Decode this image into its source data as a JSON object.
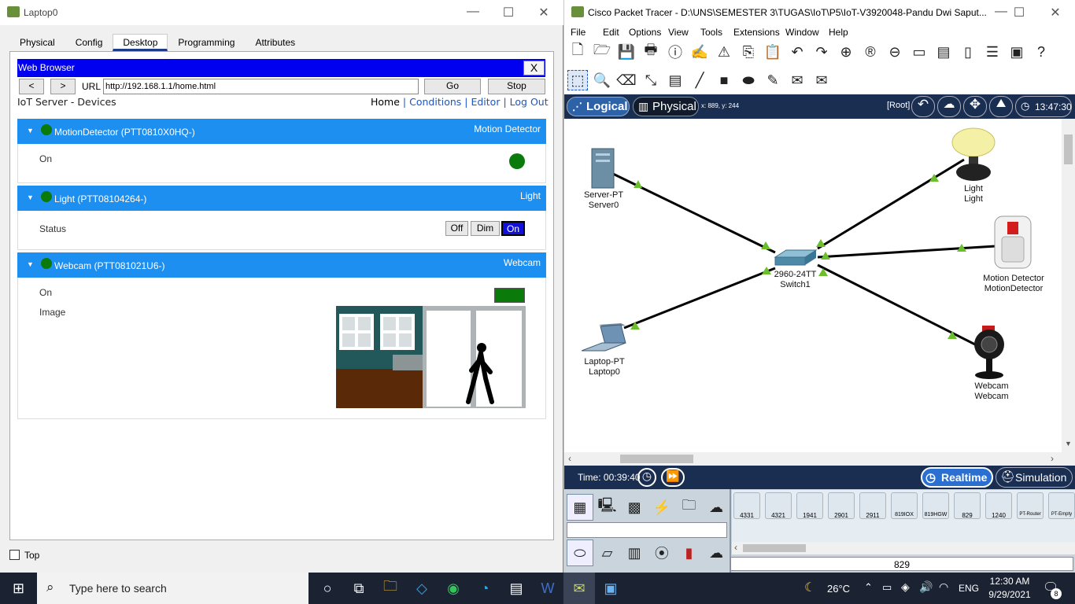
{
  "laptop": {
    "title": "Laptop0",
    "tabs": [
      "Physical",
      "Config",
      "Desktop",
      "Programming",
      "Attributes"
    ],
    "browser": {
      "bar_title": "Web Browser",
      "close": "X",
      "back": "<",
      "forward": ">",
      "url_label": "URL",
      "url": "http://192.168.1.1/home.html",
      "go": "Go",
      "stop": "Stop"
    },
    "page": {
      "heading": "IoT Server - Devices",
      "nav": {
        "home": "Home",
        "sep": "|",
        "conditions": "Conditions",
        "editor": "Editor",
        "logout": "Log Out"
      },
      "devices": [
        {
          "name": "MotionDetector (PTT0810X0HQ-)",
          "type": "Motion Detector",
          "row1_label": "On"
        },
        {
          "name": "Light (PTT08104264-)",
          "type": "Light",
          "row1_label": "Status",
          "buttons": [
            "Off",
            "Dim",
            "On"
          ]
        },
        {
          "name": "Webcam (PTT081021U6-)",
          "type": "Webcam",
          "row1_label": "On",
          "row2_label": "Image"
        }
      ]
    },
    "top_checkbox": "Top"
  },
  "pt": {
    "title": "Cisco Packet Tracer - D:\\UNS\\SEMESTER 3\\TUGAS\\IoT\\P5\\IoT-V3920048-Pandu Dwi Saput...",
    "menu": [
      "File",
      "Edit",
      "Options",
      "View",
      "Tools",
      "Extensions",
      "Window",
      "Help"
    ],
    "nav": {
      "logical": "Logical",
      "physical": "Physical",
      "coords": "x: 889, y: 244",
      "root": "[Root]",
      "clock": "13:47:30"
    },
    "nodes": {
      "server": [
        "Server-PT",
        "Server0"
      ],
      "switch": [
        "2960-24TT",
        "Switch1"
      ],
      "laptop": [
        "Laptop-PT",
        "Laptop0"
      ],
      "light": [
        "Light",
        "Light"
      ],
      "motion": [
        "Motion Detector",
        "MotionDetector"
      ],
      "webcam": [
        "Webcam",
        "Webcam"
      ]
    },
    "time": "Time: 00:39:40",
    "realtime": "Realtime",
    "simulation": "Simulation",
    "devices": [
      "4331",
      "4321",
      "1941",
      "2901",
      "2911",
      "819IOX",
      "819HGW",
      "829",
      "1240",
      "PT-Router",
      "PT-Empty"
    ],
    "selected_model": "829"
  },
  "taskbar": {
    "search_placeholder": "Type here to search",
    "weather": "26°C",
    "lang": "ENG",
    "time": "12:30 AM",
    "date": "9/29/2021",
    "notif": "8"
  }
}
